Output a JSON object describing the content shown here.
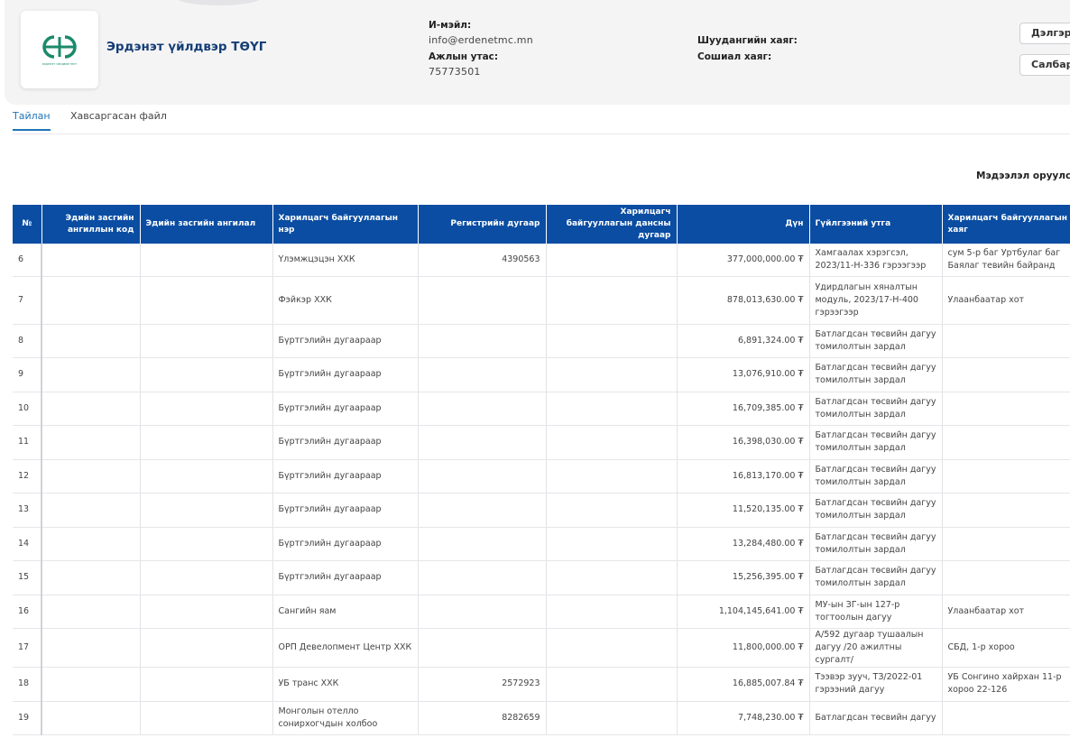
{
  "org": {
    "name": "Эрдэнэт үйлдвэр ТӨҮГ",
    "logo_caption": "ЭРДЭНЭТ ҮЙЛДВЭР ТӨҮГ",
    "brand_color": "#1b8a6b"
  },
  "contact": {
    "email_label": "И-мэйл:",
    "email": "info@erdenetmc.mn",
    "phone_label": "Ажлын утас:",
    "phone": "75773501",
    "mail_label": "Шуудангийн хаяг:",
    "social_label": "Сошиал хаяг:"
  },
  "buttons": {
    "details": "Дэлгэрэ",
    "branch": "Салбар"
  },
  "tabs": [
    {
      "label": "Тайлан",
      "active": true
    },
    {
      "label": "Хавсаргасан файл",
      "active": false
    }
  ],
  "meta": {
    "updated_label": "Мэдээлэл оруулсан"
  },
  "table": {
    "header_color": "#0a4da2",
    "columns": {
      "no": "№",
      "econ_code": "Эдийн засгийн ангиллын код",
      "econ_class": "Эдийн засгийн ангилал",
      "partner_name": "Харилцагч байгууллагын нэр",
      "reg_no": "Регистрийн дугаар",
      "account_no": "Харилцагч байгууллагын дансны дугаар",
      "amount": "Дүн",
      "purpose": "Гүйлгээний утга",
      "partner_address": "Харилцагч байгууллагын хаяг"
    },
    "rows": [
      {
        "no": "6",
        "name": "Үлэмжцэцэн ХХК",
        "reg": "4390563",
        "amount": "377,000,000.00 ₮",
        "purpose": "Хамгаалах хэрэгсэл, 2023/11-Н-336 гэрээгээр",
        "address": "сум 5-р баг Уртбулаг баг Баялаг тевийн байранд"
      },
      {
        "no": "7",
        "name": "Фэйкэр ХХК",
        "reg": "",
        "amount": "878,013,630.00 ₮",
        "purpose": "Удирдлагын хяналтын модуль, 2023/17-Н-400 гэрээгээр",
        "address": "Улаанбаатар хот"
      },
      {
        "no": "8",
        "name": "Бүртгэлийн дугаараар",
        "reg": "",
        "amount": "6,891,324.00 ₮",
        "purpose": "Батлагдсан төсвийн дагуу томилолтын зардал",
        "address": ""
      },
      {
        "no": "9",
        "name": "Бүртгэлийн дугаараар",
        "reg": "",
        "amount": "13,076,910.00 ₮",
        "purpose": "Батлагдсан төсвийн дагуу томилолтын зардал",
        "address": ""
      },
      {
        "no": "10",
        "name": "Бүртгэлийн дугаараар",
        "reg": "",
        "amount": "16,709,385.00 ₮",
        "purpose": "Батлагдсан төсвийн дагуу томилолтын зардал",
        "address": ""
      },
      {
        "no": "11",
        "name": "Бүртгэлийн дугаараар",
        "reg": "",
        "amount": "16,398,030.00 ₮",
        "purpose": "Батлагдсан төсвийн дагуу томилолтын зардал",
        "address": ""
      },
      {
        "no": "12",
        "name": "Бүртгэлийн дугаараар",
        "reg": "",
        "amount": "16,813,170.00 ₮",
        "purpose": "Батлагдсан төсвийн дагуу томилолтын зардал",
        "address": ""
      },
      {
        "no": "13",
        "name": "Бүртгэлийн дугаараар",
        "reg": "",
        "amount": "11,520,135.00 ₮",
        "purpose": "Батлагдсан төсвийн дагуу томилолтын зардал",
        "address": ""
      },
      {
        "no": "14",
        "name": "Бүртгэлийн дугаараар",
        "reg": "",
        "amount": "13,284,480.00 ₮",
        "purpose": "Батлагдсан төсвийн дагуу томилолтын зардал",
        "address": ""
      },
      {
        "no": "15",
        "name": "Бүртгэлийн дугаараар",
        "reg": "",
        "amount": "15,256,395.00 ₮",
        "purpose": "Батлагдсан төсвийн дагуу томилолтын зардал",
        "address": ""
      },
      {
        "no": "16",
        "name": "Сангийн яам",
        "reg": "",
        "amount": "1,104,145,641.00 ₮",
        "purpose": "МУ-ын ЗГ-ын 127-р тогтоолын дагуу",
        "address": "Улаанбаатар хот"
      },
      {
        "no": "17",
        "name": "ОРП Девелопмент Центр ХХК",
        "reg": "",
        "amount": "11,800,000.00 ₮",
        "purpose": "А/592 дугаар тушаалын дагуу /20 ажилтны сургалт/",
        "address": "СБД, 1-р хороо"
      },
      {
        "no": "18",
        "name": "УБ транс ХХК",
        "reg": "2572923",
        "amount": "16,885,007.84 ₮",
        "purpose": "Тээвэр зууч, ТЗ/2022-01 гэрээний дагуу",
        "address": "УБ Сонгино хайрхан 11-р хороо 22-126"
      },
      {
        "no": "19",
        "name": "Монголын отелло сонирхогчдын холбоо",
        "reg": "8282659",
        "amount": "7,748,230.00 ₮",
        "purpose": "Батлагдсан төсвийн дагуу",
        "address": ""
      }
    ]
  }
}
